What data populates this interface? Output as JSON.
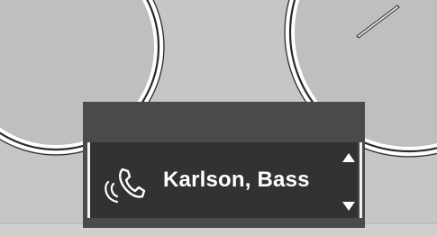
{
  "display": {
    "contact_name": "Karlson, Bass"
  },
  "icons": {
    "call": "phone-call-icon",
    "scroll_up": "triangle-up-icon",
    "scroll_down": "triangle-down-icon",
    "needle": "gauge-needle-icon"
  },
  "colors": {
    "background": "#c6c6c6",
    "panel": "#4a4a4a",
    "screen": "#323232",
    "text": "#ffffff"
  }
}
